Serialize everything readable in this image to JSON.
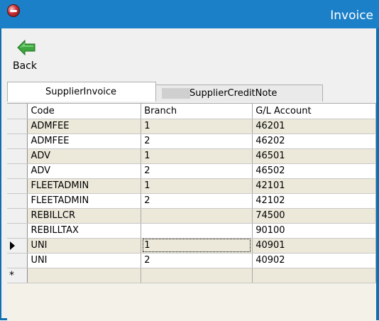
{
  "window": {
    "title": "Invoice"
  },
  "toolbar": {
    "back_label": "Back"
  },
  "tabs": [
    {
      "label": "SupplierInvoice",
      "active": true
    },
    {
      "label": "SupplierCreditNote",
      "active": false
    }
  ],
  "grid": {
    "columns": [
      "Code",
      "Branch",
      "G/L Account"
    ],
    "rows": [
      {
        "code": "ADMFEE",
        "branch": "1",
        "gl": "46201"
      },
      {
        "code": "ADMFEE",
        "branch": "2",
        "gl": "46202"
      },
      {
        "code": "ADV",
        "branch": "1",
        "gl": "46501"
      },
      {
        "code": "ADV",
        "branch": "2",
        "gl": "46502"
      },
      {
        "code": "FLEETADMIN",
        "branch": "1",
        "gl": "42101"
      },
      {
        "code": "FLEETADMIN",
        "branch": "2",
        "gl": "42102"
      },
      {
        "code": "REBILLCR",
        "branch": "",
        "gl": "74500"
      },
      {
        "code": "REBILLTAX",
        "branch": "",
        "gl": "90100"
      },
      {
        "code": "UNI",
        "branch": "1",
        "gl": "40901"
      },
      {
        "code": "UNI",
        "branch": "2",
        "gl": "40902"
      }
    ],
    "new_row_marker": "*",
    "current_row_index": 8
  },
  "colors": {
    "titlebar": "#1b80c8",
    "row_alt": "#ece8da",
    "back_arrow": "#3ea83e"
  },
  "icons": {
    "back": "green-left-arrow-icon",
    "app": "red-app-logo-icon"
  }
}
